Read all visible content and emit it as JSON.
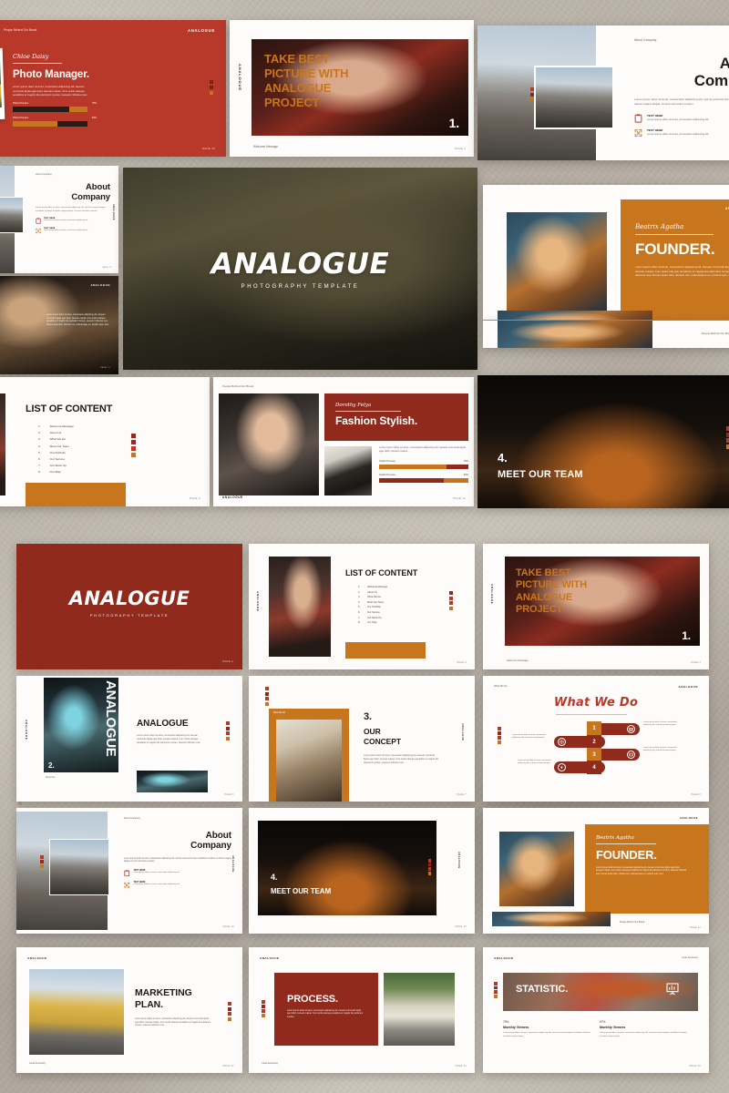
{
  "brand": {
    "name": "ANALOGUE",
    "tagline": "PHOTOGRAPHY TEMPLATE"
  },
  "colors": {
    "red": "#8f2a1c",
    "red_bright": "#b8392a",
    "orange": "#c8761e",
    "dark": "#241c18",
    "paper": "#fdfcfa",
    "backdrop": "#b9b2a8"
  },
  "lorem": {
    "short": "Lorem ipsum dolor sit amet, consectetur adipiscing elit.",
    "medium": "Lorem ipsum dolor sit amet, consectetur adipiscing elit, sed do eiusmod tempor incididunt ut labore et dolore magna aliqua. Ut enim ad minim veniam.",
    "long": "Lorem ipsum dolor sit amet, consectetur adipiscing elit. Aenean commodo ligula eget dolor. Aenean massa. Cum sociis natoque penatibus et magnis dis parturient montes, nascetur ridiculus mus.",
    "xlong": "Lorem ipsum dolor sit amet, consectetur adipiscing elit. Aenean commodo ligula eget dolor. Aenean massa. Cum sociis natoque penatibus et magnis dis parturient montes, nascetur ridiculus mus. Donec quam felis, ultricies nec, pellentesque eu, pretium quis, sem."
  },
  "slides": {
    "photo_manager": {
      "brand": "ANALOGUE",
      "eyebrow": "People Behind Our Brand",
      "name": "Chloe Daisy",
      "title": "Photo Manager.",
      "body": "Lorem ipsum dolor sit amet, consectetur adipiscing elit. Aenean commodo ligula eget dolor. Aenean massa. Cum sociis natoque penatibus et magnis dis parturient montes, nascetur ridiculus mus.",
      "bars": [
        {
          "label": "Photo Process",
          "value": "75%",
          "pct": 75
        },
        {
          "label": "Photo Process",
          "value": "60%",
          "pct": 60
        }
      ],
      "page": "PAGE 13"
    },
    "take_best": {
      "vbrand": "ANALOGUE",
      "title_lines": [
        "TAKE BEST",
        "PICTURE WITH",
        "ANALOGUE",
        "PROJECT"
      ],
      "number": "1.",
      "footer": "Welcome Message",
      "page": "PAGE 4"
    },
    "about_company": {
      "eyebrow": "About Company",
      "title_lines": [
        "About",
        "Company"
      ],
      "vbrand": "ANALOGUE",
      "body": "Lorem ipsum dolor sit amet, consectetur adipiscing elit, sed do eiusmod tempor incididunt ut labore et dolore magna aliqua. Ut enim ad minim veniam.",
      "features": [
        {
          "icon": "clipboard-icon",
          "title": "TEXT HERE",
          "body": "Lorem ipsum dolor sit amet, consectetur adipiscing elit."
        },
        {
          "icon": "expand-icon",
          "title": "TEXT HERE",
          "body": "Lorem ipsum dolor sit amet, consectetur adipiscing elit."
        }
      ],
      "page": "PAGE 10"
    },
    "hero": {
      "title": "ANALOGUE",
      "sub": "PHOTOGRAPHY TEMPLATE"
    },
    "dark_portrait": {
      "vbrand": "ANALOGUE",
      "brand": "ANALOGUE",
      "body": "Lorem ipsum dolor sit amet, consectetur adipiscing elit. Aenean commodo ligula eget dolor. Aenean massa. Cum sociis natoque penatibus et magnis dis parturient montes, nascetur ridiculus mus. Donec quam felis, ultricies nec, pellentesque eu, pretium quis, sem.",
      "page": "PAGE 11"
    },
    "founder": {
      "brand": "ANALOGUE",
      "name": "Beatrix Agatha",
      "title": "FOUNDER.",
      "body": "Lorem ipsum dolor sit amet, consectetur adipiscing elit. Aenean commodo ligula eget dolor. Aenean massa. Cum sociis natoque penatibus et magnis dis parturient montes, nascetur ridiculus mus. Donec quam felis, ultricies nec, pellentesque eu, pretium quis, sem.",
      "footer": "People Behind Our Brand",
      "page": "PAGE 12"
    },
    "list_of_content": {
      "title": "LIST OF CONTENT",
      "items": [
        {
          "n": "1.",
          "label": "Welcome Message"
        },
        {
          "n": "2.",
          "label": "About Us"
        },
        {
          "n": "3.",
          "label": "What We Do"
        },
        {
          "n": "4.",
          "label": "Meet Our Team"
        },
        {
          "n": "5.",
          "label": "Our Portfolio"
        },
        {
          "n": "6.",
          "label": "Our Service"
        },
        {
          "n": "7.",
          "label": "Our Mock Up"
        },
        {
          "n": "8.",
          "label": "Our Map"
        }
      ],
      "page": "PAGE 3"
    },
    "fashion_stylish": {
      "eyebrow": "People Behind Our Brand",
      "brand": "ANALOGUE",
      "name": "Dorothy Felya",
      "title": "Fashion Stylish.",
      "body": "Lorem ipsum dolor sit amet, consectetur adipiscing elit. Aenean commodo ligula eget dolor. Aenean massa.",
      "bars": [
        {
          "label": "Stylish Process",
          "value": "75%",
          "pct": 75
        },
        {
          "label": "Stylish Process",
          "value": "60%",
          "pct": 60
        }
      ],
      "page": "PAGE 14"
    },
    "meet_team": {
      "number": "4.",
      "title": "MEET OUR TEAM",
      "vbrand": "ANALOGUE",
      "page": "PAGE 15"
    },
    "title_red": {
      "title": "ANALOGUE",
      "sub": "PHOTOGRAPHY TEMPLATE",
      "page": "PAGE 2"
    },
    "analogue_about": {
      "vbrand": "ANALOGUE",
      "vertical_overlay": "ANALOGUE",
      "number": "2.",
      "title": "ANALOGUE",
      "footer": "About Us",
      "body": "Lorem ipsum dolor sit amet, consectetur adipiscing elit. Aenean commodo ligula eget dolor. Aenean massa. Cum sociis natoque penatibus et magnis dis parturient montes, nascetur ridiculus mus.",
      "page": "PAGE 5"
    },
    "our_concept": {
      "badge": "What We Do",
      "number": "3.",
      "title_lines": [
        "OUR",
        "CONCEPT"
      ],
      "vbrand": "ANALOGUE",
      "body": "Lorem ipsum dolor sit amet, consectetur adipiscing elit. Aenean commodo ligula eget dolor. Aenean massa. Cum sociis natoque penatibus et magnis dis parturient montes, nascetur ridiculus mus.",
      "page": "PAGE 7"
    },
    "what_we_do": {
      "eyebrow": "What We Do",
      "brand": "ANALOGUE",
      "title": "What We Do",
      "steps": [
        {
          "n": "1",
          "icon": "camera-icon",
          "body": "Lorem ipsum dolor sit amet, consectetur adipiscing elit, sed do eiusmod tempor."
        },
        {
          "n": "2",
          "icon": "aperture-icon",
          "body": "Lorem ipsum dolor sit amet, consectetur adipiscing elit, sed do eiusmod tempor."
        },
        {
          "n": "3",
          "icon": "film-icon",
          "body": "Lorem ipsum dolor sit amet, consectetur adipiscing elit, sed do eiusmod tempor."
        },
        {
          "n": "4",
          "icon": "flash-icon",
          "body": "Lorem ipsum dolor sit amet, consectetur adipiscing elit, sed do eiusmod tempor."
        }
      ],
      "page": "PAGE 8"
    },
    "marketing_plan": {
      "brand": "ANALOGUE",
      "title_lines": [
        "MARKETING",
        "PLAN."
      ],
      "body": "Lorem ipsum dolor sit amet, consectetur adipiscing elit. Aenean commodo ligula eget dolor. Aenean massa. Cum sociis natoque penatibus et magnis dis parturient montes, nascetur ridiculus mus.",
      "footer": "Great Sectionary",
      "page": "PAGE 21"
    },
    "process": {
      "brand": "ANALOGUE",
      "title": "PROCESS.",
      "body": "Lorem ipsum dolor sit amet, consectetur adipiscing elit. Aenean commodo ligula eget dolor. Aenean massa. Cum sociis natoque penatibus et magnis dis parturient montes.",
      "footer": "Great Sectionary",
      "page": "PAGE 24"
    },
    "statistic": {
      "brand": "ANALOGUE",
      "eyebrow": "Great Sectionary",
      "title": "STATISTIC.",
      "icon": "presentation-chart-icon",
      "stats": [
        {
          "value": "79%",
          "label": "Monthly Viewers",
          "body": "Lorem ipsum dolor sit amet, consectetur adipiscing elit, sed do eiusmod tempor incididunt ut labore et dolore magna aliqua."
        },
        {
          "value": "97%",
          "label": "Monthly Viewers",
          "body": "Lorem ipsum dolor sit amet, consectetur adipiscing elit, sed do eiusmod tempor incididunt ut labore et dolore magna aliqua."
        }
      ],
      "page": "PAGE 29"
    }
  }
}
